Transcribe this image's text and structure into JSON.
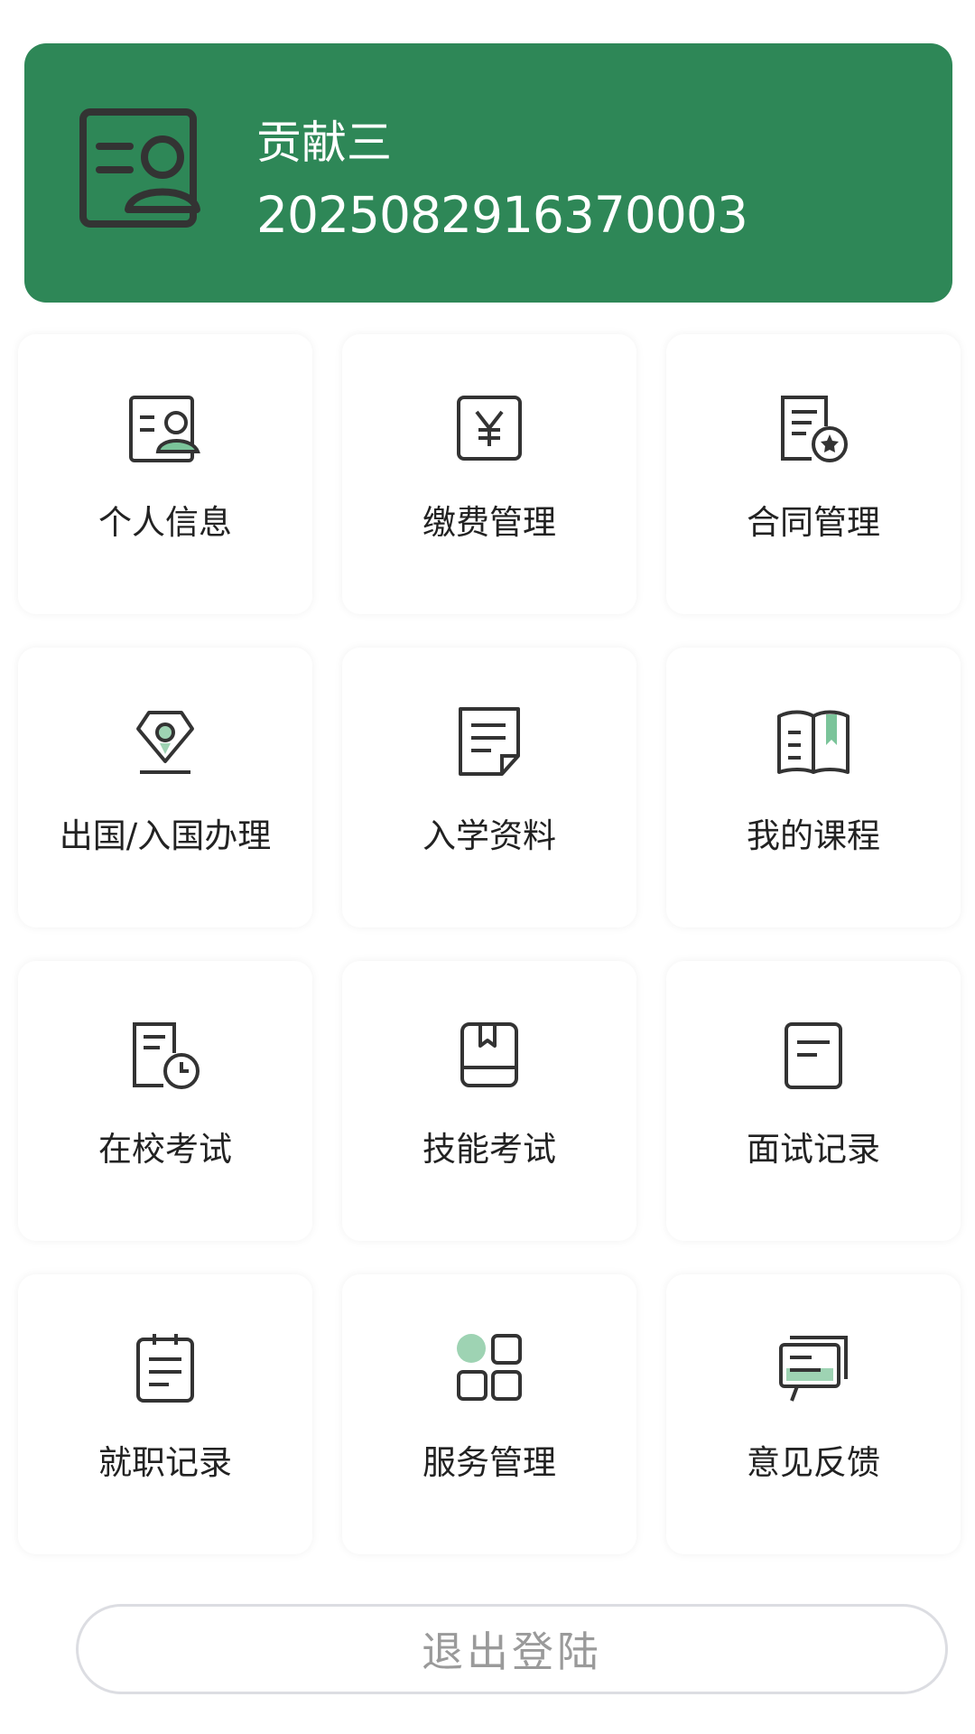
{
  "colors": {
    "accent": "#2e8757",
    "text": "#222222",
    "muted": "#9a9a9a"
  },
  "profile": {
    "name": "贡献三",
    "student_id": "2025082916370003",
    "icon": "id-card-icon"
  },
  "menu": [
    {
      "label": "个人信息",
      "icon": "id-card-icon"
    },
    {
      "label": "缴费管理",
      "icon": "yuan-icon"
    },
    {
      "label": "合同管理",
      "icon": "contract-star-icon"
    },
    {
      "label": "出国/入国办理",
      "icon": "location-pin-icon"
    },
    {
      "label": "入学资料",
      "icon": "document-icon"
    },
    {
      "label": "我的课程",
      "icon": "open-book-icon"
    },
    {
      "label": "在校考试",
      "icon": "exam-clock-icon"
    },
    {
      "label": "技能考试",
      "icon": "book-icon"
    },
    {
      "label": "面试记录",
      "icon": "note-icon"
    },
    {
      "label": "就职记录",
      "icon": "clipboard-icon"
    },
    {
      "label": "服务管理",
      "icon": "grid-icon"
    },
    {
      "label": "意见反馈",
      "icon": "chat-icon"
    }
  ],
  "logout_label": "退出登陆"
}
